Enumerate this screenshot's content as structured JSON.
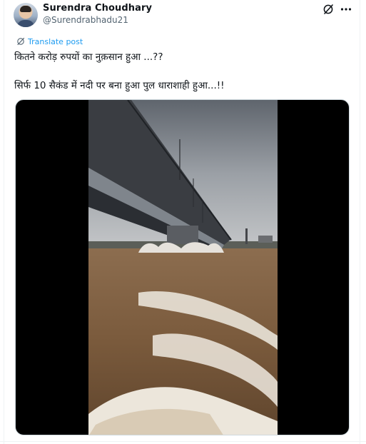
{
  "author": {
    "name": "Surendra Choudhary",
    "handle": "@Surendrabhadu21"
  },
  "post": {
    "translate_label": "Translate post",
    "line1": "कितने करोड़ रुपयों का नुक़सान हुआ ...??",
    "line2": "सिर्फ 10 सैकंड में नदी पर बना हुआ पुल धाराशाही हुआ...!!"
  },
  "icons": {
    "grok": "grok-icon",
    "more": "more-icon",
    "translate": "translate-icon"
  },
  "colors": {
    "link": "#1d9bf0",
    "text": "#0f1419",
    "secondary": "#536471",
    "water": "#7a5a3c",
    "sky": "#8a8f96"
  }
}
